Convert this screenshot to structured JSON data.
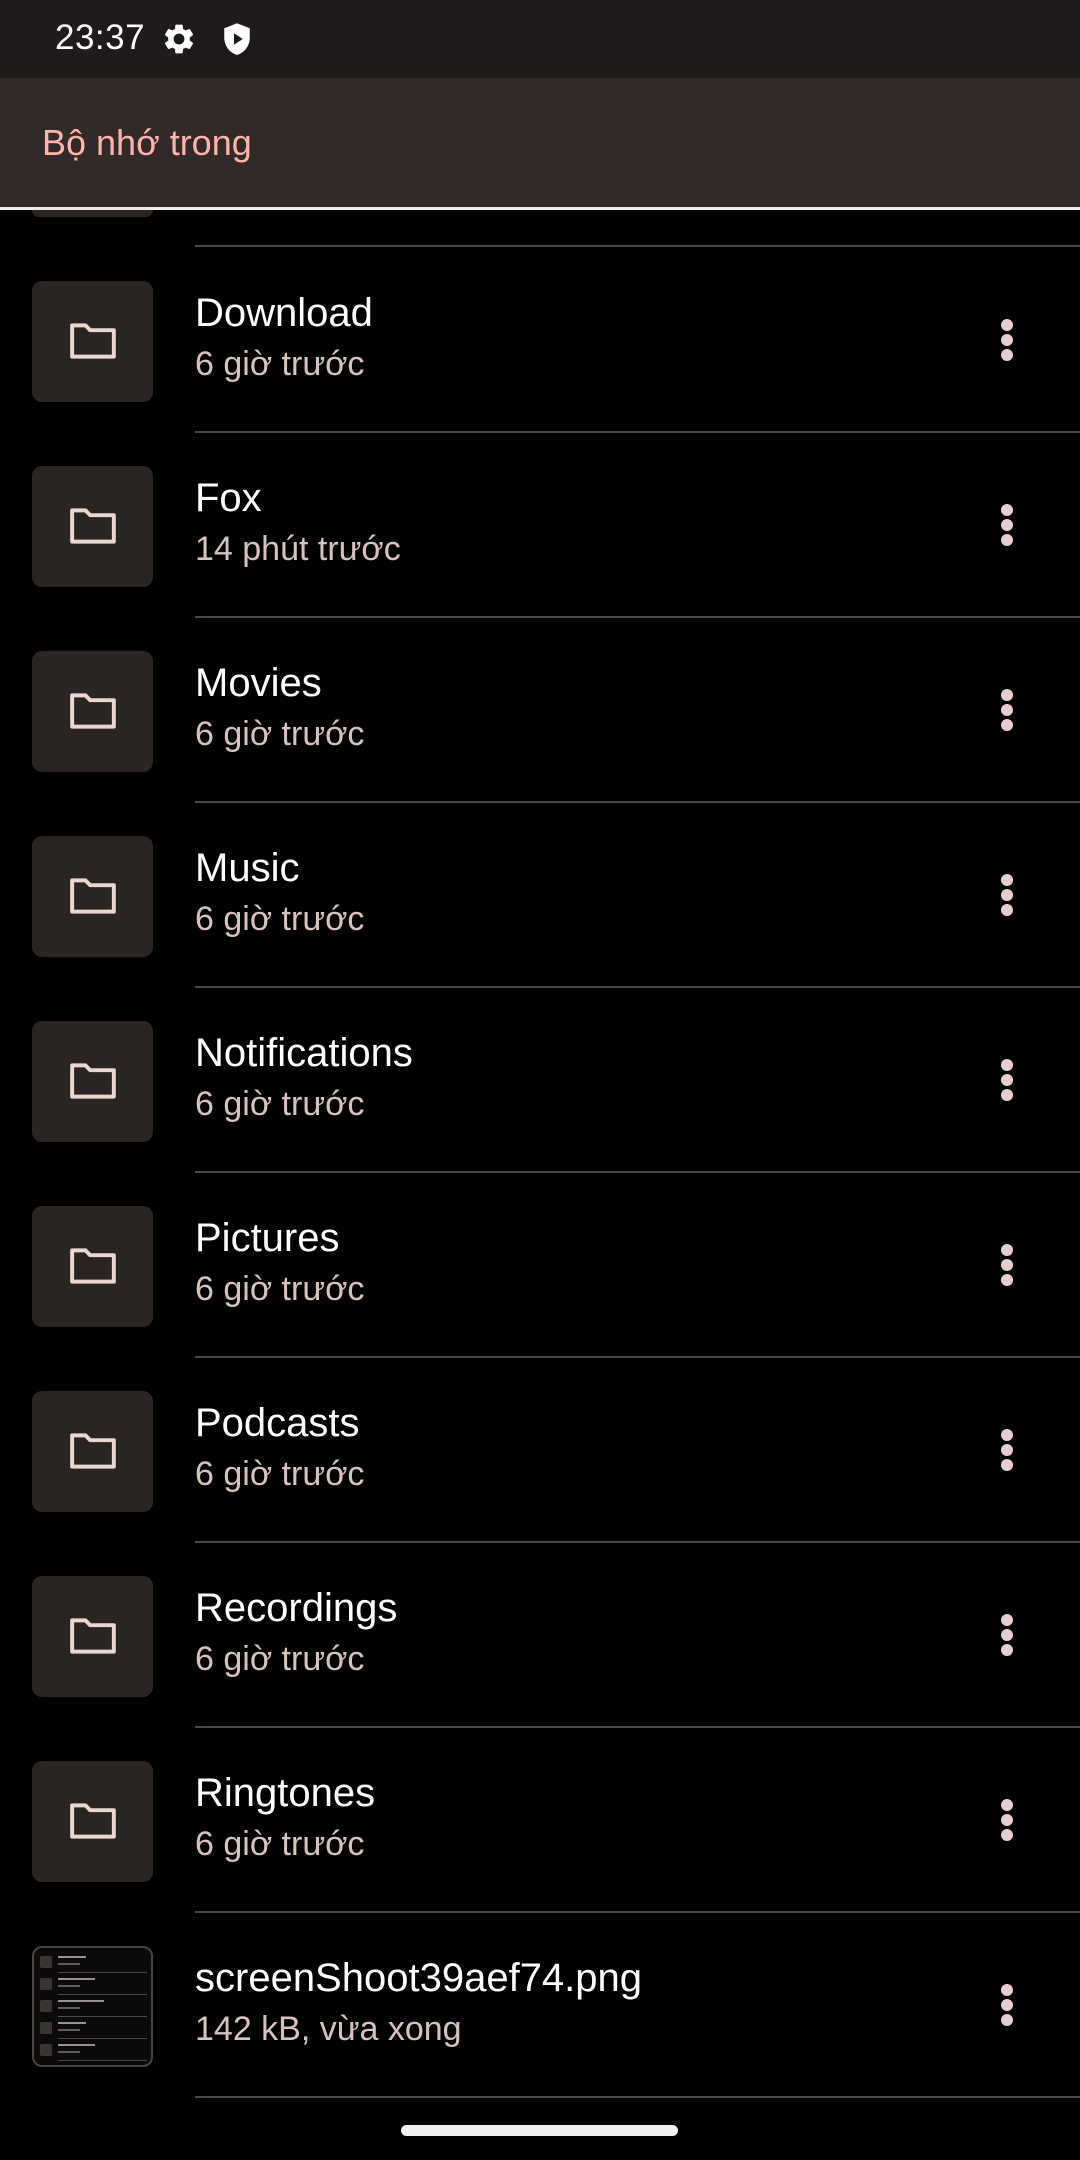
{
  "status_bar": {
    "time": "23:37",
    "icons": [
      "gear-icon",
      "shield-play-icon"
    ]
  },
  "app_bar": {
    "title": "Bộ nhớ trong"
  },
  "colors": {
    "accent": "#ffb4a8",
    "app_bar_bg": "#312a28",
    "thumb_bg": "#2a2422"
  },
  "items": [
    {
      "name": "Download",
      "subtitle": "6 giờ trước",
      "icon": "folder-icon"
    },
    {
      "name": "Fox",
      "subtitle": "14 phút trước",
      "icon": "folder-icon"
    },
    {
      "name": "Movies",
      "subtitle": "6 giờ trước",
      "icon": "folder-icon"
    },
    {
      "name": "Music",
      "subtitle": "6 giờ trước",
      "icon": "folder-icon"
    },
    {
      "name": "Notifications",
      "subtitle": "6 giờ trước",
      "icon": "folder-icon"
    },
    {
      "name": "Pictures",
      "subtitle": "6 giờ trước",
      "icon": "folder-icon"
    },
    {
      "name": "Podcasts",
      "subtitle": "6 giờ trước",
      "icon": "folder-icon"
    },
    {
      "name": "Recordings",
      "subtitle": "6 giờ trước",
      "icon": "folder-icon"
    },
    {
      "name": "Ringtones",
      "subtitle": "6 giờ trước",
      "icon": "folder-icon"
    },
    {
      "name": "screenShoot39aef74.png",
      "subtitle": "142 kB, vừa xong",
      "icon": "image-thumbnail"
    }
  ]
}
